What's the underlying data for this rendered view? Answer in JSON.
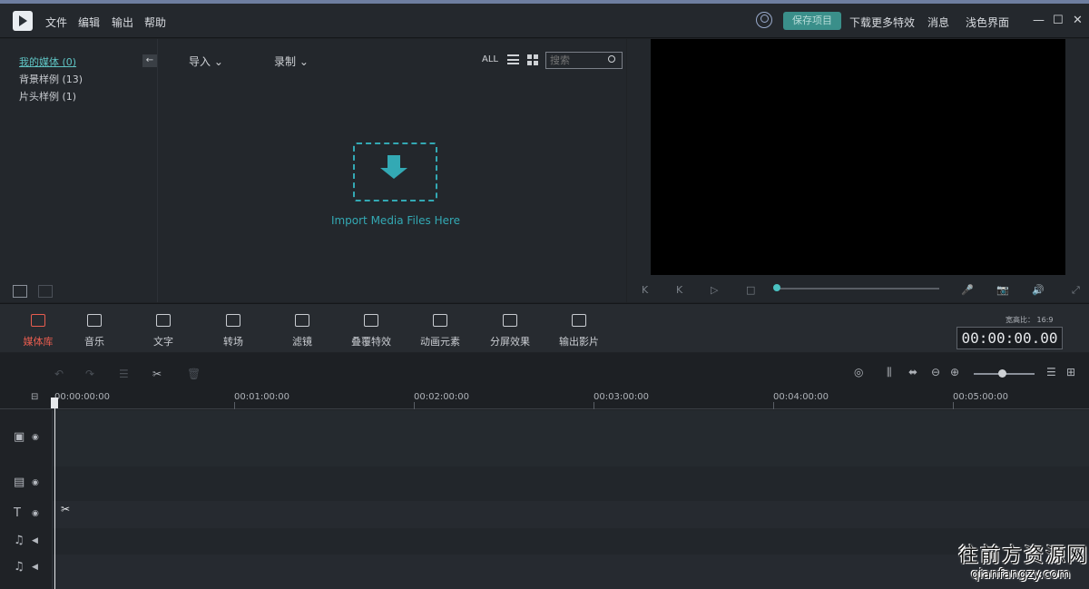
{
  "menubar": {
    "items": [
      "文件",
      "编辑",
      "输出",
      "帮助"
    ],
    "save_label": "保存项目",
    "more_effects": "下载更多特效",
    "messages": "消息",
    "light_theme": "浅色界面",
    "minimize": "—",
    "maximize": "☐",
    "close": "✕"
  },
  "library": {
    "items": [
      {
        "label": "我的媒体 (0)",
        "active": true
      },
      {
        "label": "背景样例 (13)"
      },
      {
        "label": "片头样例 (1)"
      }
    ],
    "back_glyph": "←"
  },
  "media_toolbar": {
    "import": "导入",
    "record": "录制",
    "filter_all": "ALL",
    "search_placeholder": "搜索"
  },
  "dropzone": {
    "text": "Import Media Files Here"
  },
  "preview_controls": {
    "rewind": "K",
    "step": "K",
    "play": "▷",
    "stop": "□",
    "mic": "🎤",
    "camera": "📷",
    "volume": "🔊",
    "fullscreen": "⤢",
    "progress": 0
  },
  "tools": [
    {
      "label": "媒体库",
      "icon": "folder-icon",
      "active": true
    },
    {
      "label": "音乐",
      "icon": "music-icon"
    },
    {
      "label": "文字",
      "icon": "text-icon"
    },
    {
      "label": "转场",
      "icon": "transition-icon"
    },
    {
      "label": "滤镜",
      "icon": "filter-icon"
    },
    {
      "label": "叠覆特效",
      "icon": "overlay-icon"
    },
    {
      "label": "动画元素",
      "icon": "elements-icon"
    },
    {
      "label": "分屏效果",
      "icon": "split-screen-icon"
    },
    {
      "label": "输出影片",
      "icon": "export-icon"
    }
  ],
  "aspect": {
    "label": "宽高比：",
    "value": "16:9"
  },
  "timecode": "00:00:00.00",
  "ruler": {
    "labels": [
      "00:00:00:00",
      "00:01:00:00",
      "00:02:00:00",
      "00:03:00:00",
      "00:04:00:00",
      "00:05:00:00"
    ]
  },
  "watermark": {
    "line1": "往前方资源网",
    "line2": "qianfangzy.com"
  }
}
